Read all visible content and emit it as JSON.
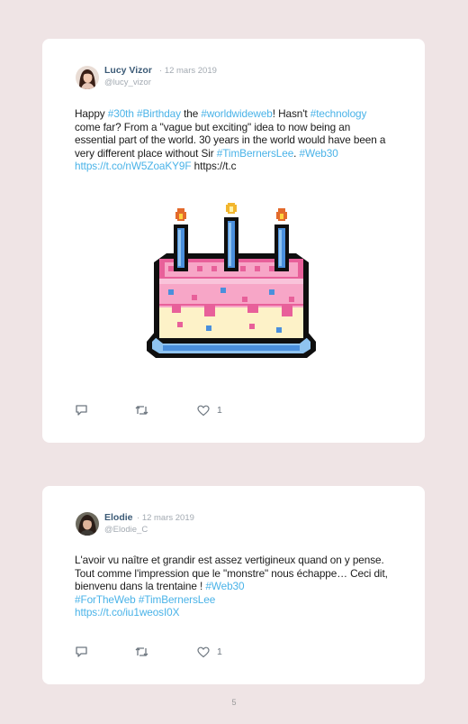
{
  "page": {
    "number": "5"
  },
  "colors": {
    "background": "#efe4e5",
    "card": "#ffffff",
    "name": "#3b5a76",
    "link": "#4ab3e8",
    "muted": "#a3aab2"
  },
  "tweets": [
    {
      "author": "Lucy Vizor",
      "separator": "·",
      "date": "12 mars 2019",
      "handle": "@lucy_vizor",
      "text": {
        "s1": "Happy ",
        "h1": "#30th",
        "s2": " ",
        "h2": "#Birthday",
        "s3": " the ",
        "h3": "#worldwideweb",
        "s4": "! Hasn't ",
        "h4": "#technology",
        "s5": " come far? From a \"vague but exciting\" idea to now being an essential part of the world. 30 years in the world would have been a very different place without Sir ",
        "h5": "#TimBernersLee",
        "s6": ". ",
        "h6": "#Web30",
        "link": "https://t.co/nW5ZoaKY9F",
        "s7": " https://t.c"
      },
      "media": "pixel-art-birthday-cake-image",
      "actions": {
        "reply_icon": "reply-icon",
        "retweet_icon": "retweet-icon",
        "like_icon": "heart-icon",
        "likes": "1"
      }
    },
    {
      "author": "Elodie",
      "separator": "·",
      "date": "12 mars 2019",
      "handle": "@Elodie_C",
      "text": {
        "s1": "L'avoir vu naître et grandir est assez vertigineux quand on y pense. Tout comme l'impression que le \"monstre\" nous échappe… Ceci dit, bienvenu dans la trentaine ! ",
        "h1": "#Web30",
        "h2": "#ForTheWeb",
        "s2": " ",
        "h3": "#TimBernersLee",
        "link": "https://t.co/iu1weosI0X"
      },
      "actions": {
        "reply_icon": "reply-icon",
        "retweet_icon": "retweet-icon",
        "like_icon": "heart-icon",
        "likes": "1"
      }
    }
  ]
}
